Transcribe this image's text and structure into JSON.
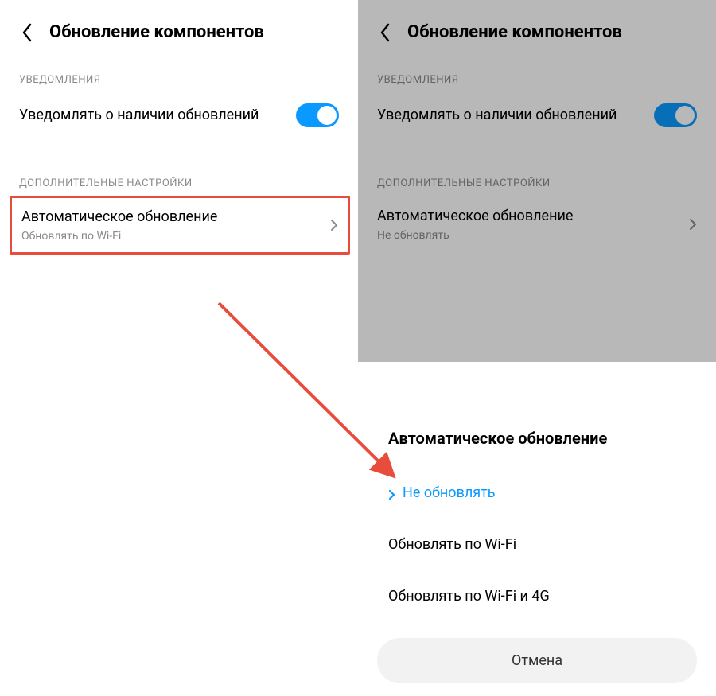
{
  "colors": {
    "accent": "#0a99ff",
    "highlight": "#e74c3c",
    "text": "#000000",
    "muted": "#8a8a8a"
  },
  "left": {
    "title": "Обновление компонентов",
    "section_notifications": "УВЕДОМЛЕНИЯ",
    "notify_label": "Уведомлять о наличии обновлений",
    "section_additional": "ДОПОЛНИТЕЛЬНЫЕ НАСТРОЙКИ",
    "auto_update_title": "Автоматическое обновление",
    "auto_update_sub": "Обновлять по Wi-Fi"
  },
  "right": {
    "title": "Обновление компонентов",
    "section_notifications": "УВЕДОМЛЕНИЯ",
    "notify_label": "Уведомлять о наличии обновлений",
    "section_additional": "ДОПОЛНИТЕЛЬНЫЕ НАСТРОЙКИ",
    "auto_update_title": "Автоматическое обновление",
    "auto_update_sub": "Не обновлять"
  },
  "sheet": {
    "title": "Автоматическое обновление",
    "option_none": "Не обновлять",
    "option_wifi": "Обновлять по Wi-Fi",
    "option_wifi_4g": "Обновлять по Wi-Fi и 4G",
    "cancel": "Отмена"
  }
}
